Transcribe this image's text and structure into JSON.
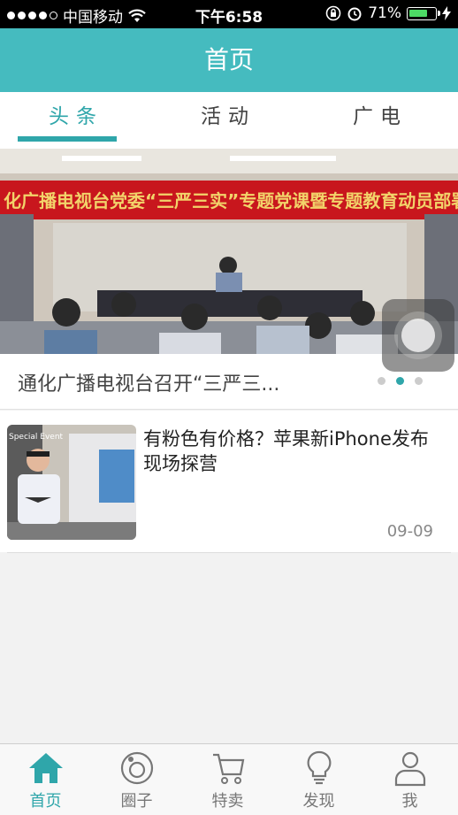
{
  "status_bar": {
    "carrier": "中国移动",
    "time": "下午6:58",
    "battery": "71%"
  },
  "navbar": {
    "title": "首页"
  },
  "tabs": [
    {
      "label": "头条",
      "active": true
    },
    {
      "label": "活动",
      "active": false
    },
    {
      "label": "广电",
      "active": false
    }
  ],
  "banner": {
    "slogan": "化广播电视台党委“三严三实”专题党课暨专题教育动员部署会议",
    "caption": "通化广播电视台召开“三严三...",
    "slide_count": 3,
    "current_slide": 2
  },
  "news": [
    {
      "title": "有粉色有价格？苹果新iPhone发布现场探营",
      "date": "09-09",
      "thumb_text": "Special Event"
    }
  ],
  "tabbar": [
    {
      "label": "首页",
      "icon": "home-icon",
      "active": true
    },
    {
      "label": "圈子",
      "icon": "circle-icon",
      "active": false
    },
    {
      "label": "特卖",
      "icon": "cart-icon",
      "active": false
    },
    {
      "label": "发现",
      "icon": "bulb-icon",
      "active": false
    },
    {
      "label": "我",
      "icon": "user-icon",
      "active": false
    }
  ],
  "colors": {
    "accent": "#2fa6aa",
    "navbar": "#45bbbf"
  }
}
